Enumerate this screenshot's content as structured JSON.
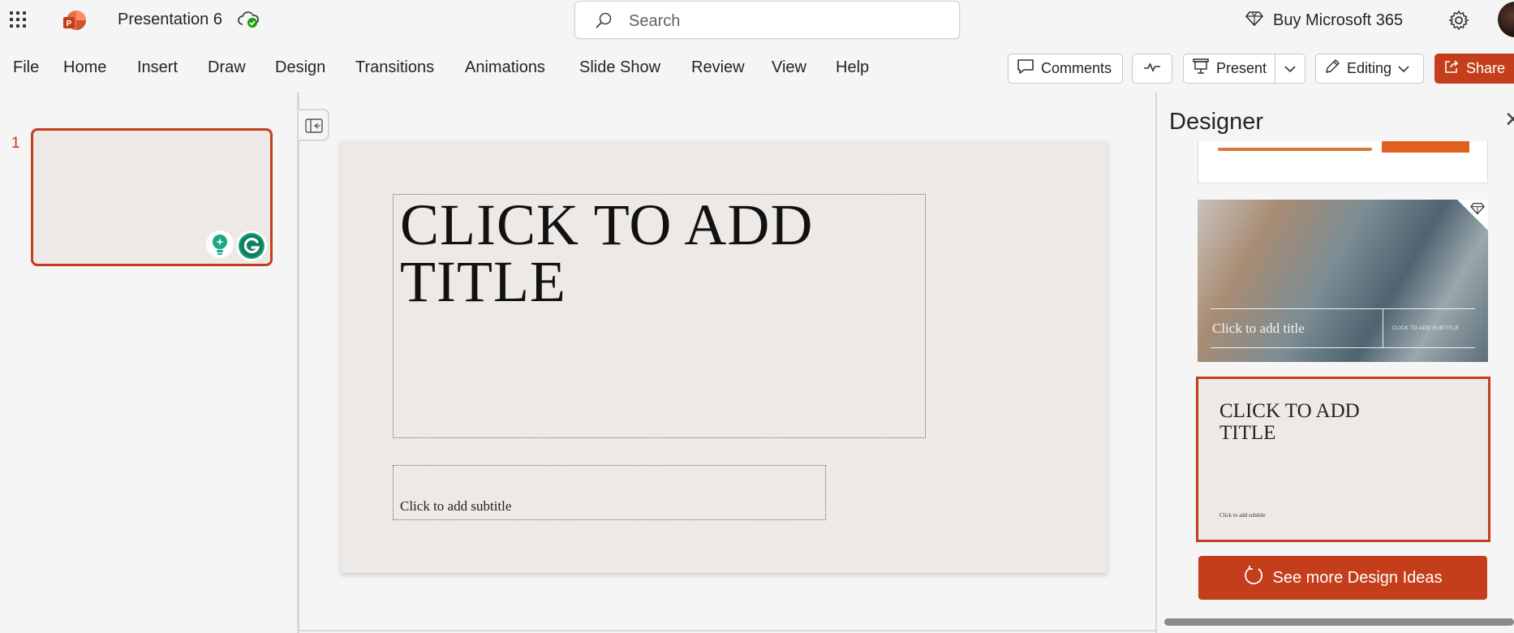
{
  "titlebar": {
    "doc_title": "Presentation 6",
    "search_placeholder": "Search",
    "buy_label": "Buy Microsoft 365"
  },
  "menu": {
    "items": [
      "File",
      "Home",
      "Insert",
      "Draw",
      "Design",
      "Transitions",
      "Animations",
      "Slide Show",
      "Review",
      "View",
      "Help"
    ]
  },
  "toolbar": {
    "comments": "Comments",
    "present": "Present",
    "editing": "Editing",
    "share": "Share"
  },
  "thumbnails": {
    "number": "1"
  },
  "slide": {
    "title_placeholder": "CLICK TO ADD TITLE",
    "subtitle_placeholder": "Click to add subtitle"
  },
  "designer": {
    "title": "Designer",
    "card2_title": "Click to add title",
    "card2_subtitle": "CLICK TO ADD SUBTITLE",
    "card3_title": "CLICK TO ADD TITLE",
    "card3_subtitle": "Click to add subtitle",
    "more_label": "See more Design Ideas"
  },
  "colors": {
    "accent": "#c43e1c",
    "slide_bg": "#ede9e6",
    "chrome_bg": "#f5f5f5"
  },
  "icons": [
    "app-launcher-icon",
    "powerpoint-logo-icon",
    "cloud-saved-icon",
    "search-icon",
    "diamond-icon",
    "gear-icon",
    "comment-icon",
    "catch-up-icon",
    "present-icon",
    "chevron-down-icon",
    "pencil-icon",
    "share-icon",
    "collapse-panel-icon",
    "refresh-icon"
  ]
}
